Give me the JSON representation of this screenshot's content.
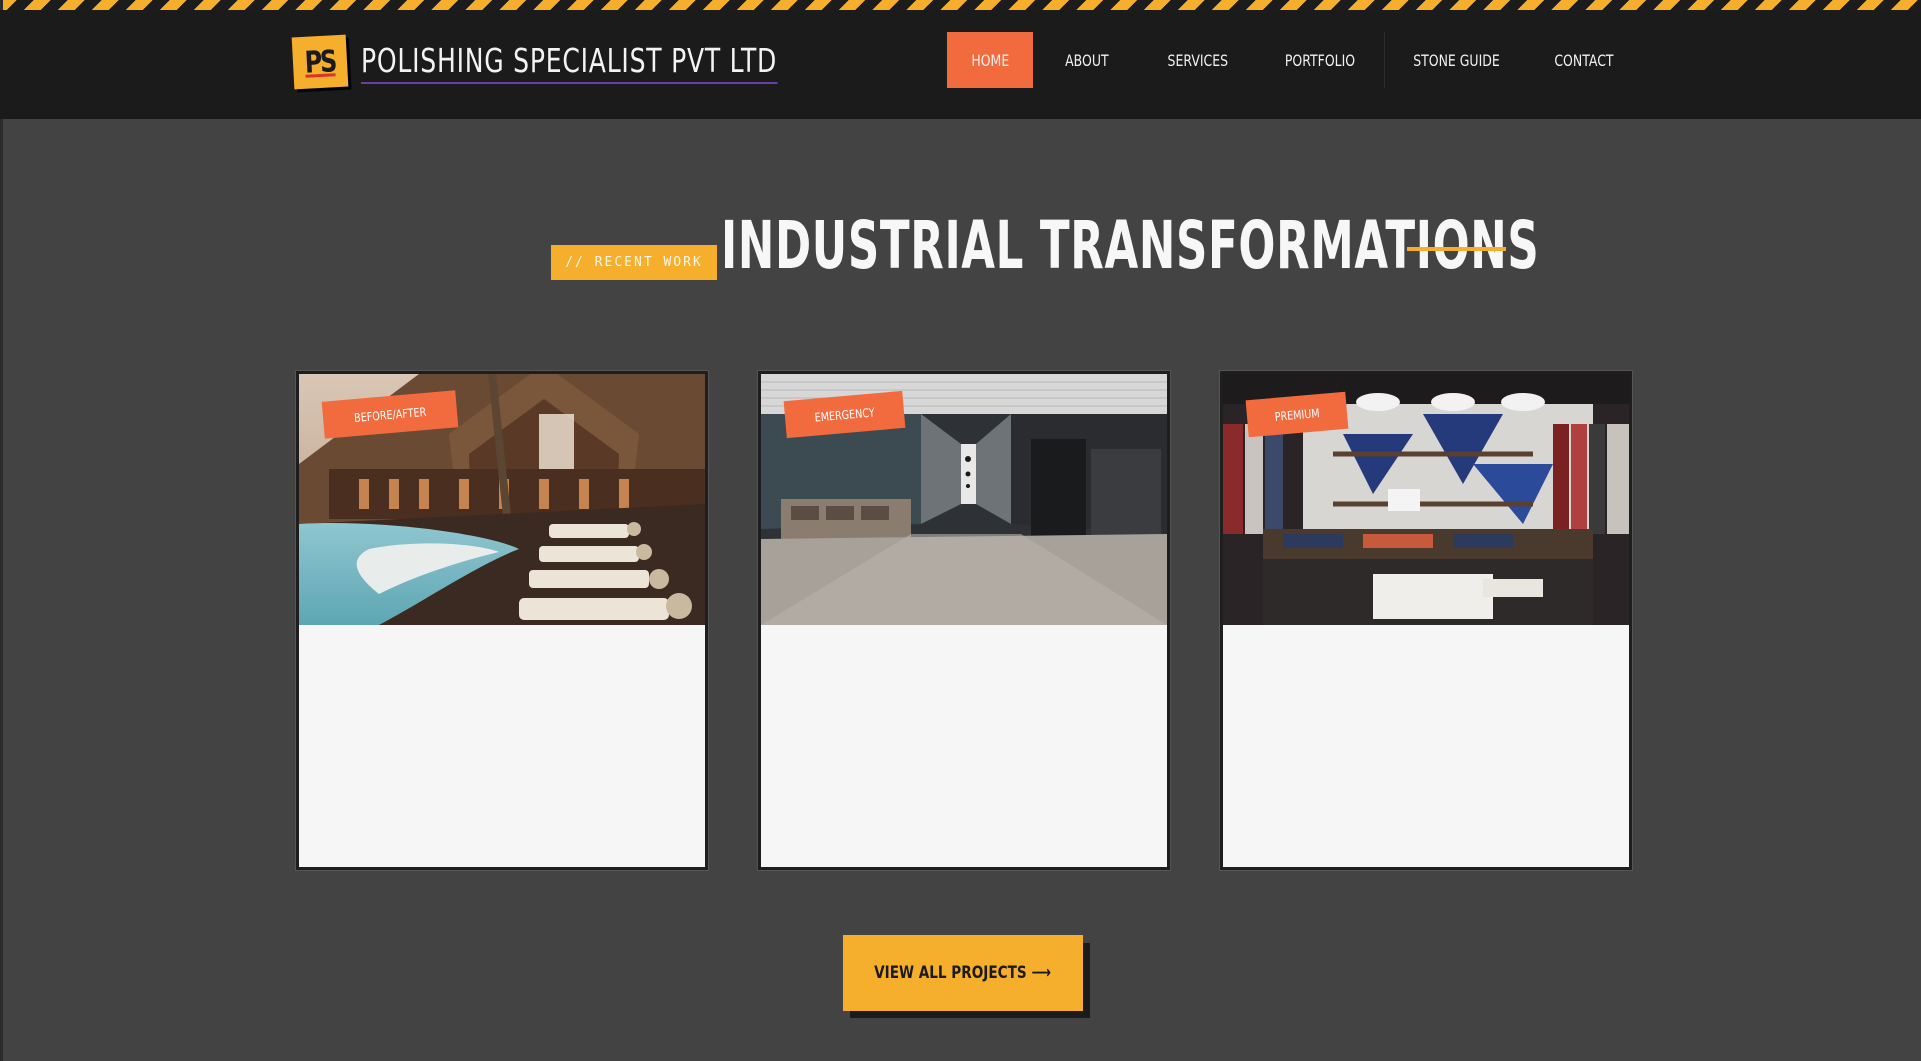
{
  "header": {
    "logo_text": "PS",
    "brand": "POLISHING SPECIALIST PVT LTD",
    "nav": [
      {
        "label": "HOME",
        "active": true
      },
      {
        "label": "ABOUT",
        "active": false
      },
      {
        "label": "SERVICES",
        "active": false
      },
      {
        "label": "PORTFOLIO",
        "active": false
      },
      {
        "label": "STONE GUIDE",
        "active": false
      },
      {
        "label": "CONTACT",
        "active": false
      }
    ]
  },
  "section": {
    "tag": "// RECENT WORK",
    "title": "INDUSTRIAL TRANSFORMATIONS"
  },
  "projects": [
    {
      "badge": "BEFORE/AFTER",
      "image": "resort-pool-photo"
    },
    {
      "badge": "EMERGENCY",
      "image": "office-corridor-photo"
    },
    {
      "badge": "PREMIUM",
      "image": "retail-store-photo"
    }
  ],
  "cta": {
    "label": "VIEW ALL PROJECTS ⟶"
  },
  "colors": {
    "accent_yellow": "#f6ae2d",
    "accent_orange": "#f26b3f",
    "header_bg": "#1b1b1b",
    "page_bg": "#434343"
  }
}
